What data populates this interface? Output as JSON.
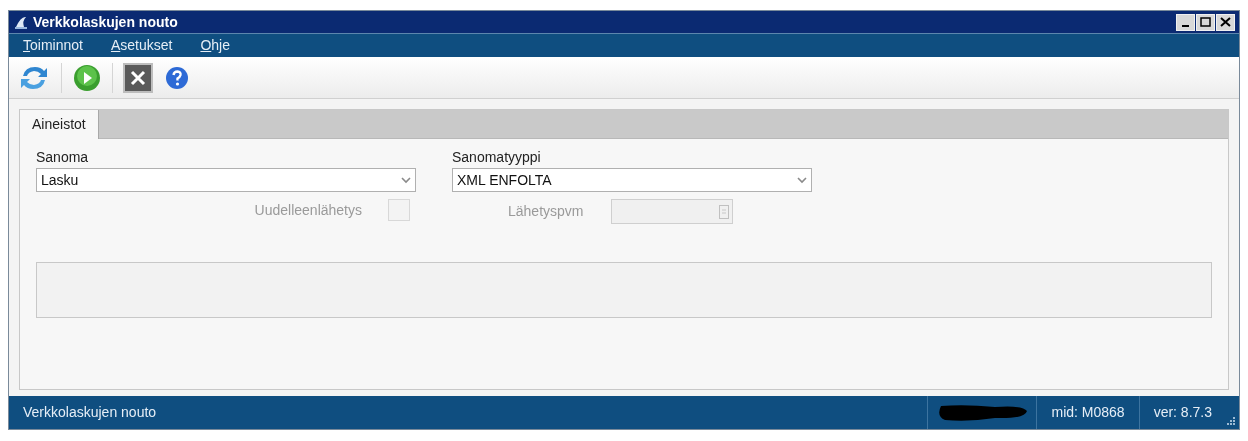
{
  "window": {
    "title": "Verkkolaskujen nouto"
  },
  "menu": [
    {
      "label": "Toiminnot"
    },
    {
      "label": "Asetukset"
    },
    {
      "label": "Ohje"
    }
  ],
  "tabs": [
    {
      "label": "Aineistot",
      "selected": true
    }
  ],
  "form": {
    "sanoma": {
      "label": "Sanoma",
      "value": "Lasku"
    },
    "sanomatyyppi": {
      "label": "Sanomatyyppi",
      "value": "XML ENFOLTA"
    },
    "resend": {
      "label": "Uudelleenlähetys",
      "checked": false,
      "disabled": true
    },
    "send_date": {
      "label": "Lähetyspvm",
      "disabled": true
    }
  },
  "status_bar": {
    "text": "Verkkolaskujen nouto",
    "mid": "mid: M0868",
    "version": "ver: 8.7.3"
  }
}
